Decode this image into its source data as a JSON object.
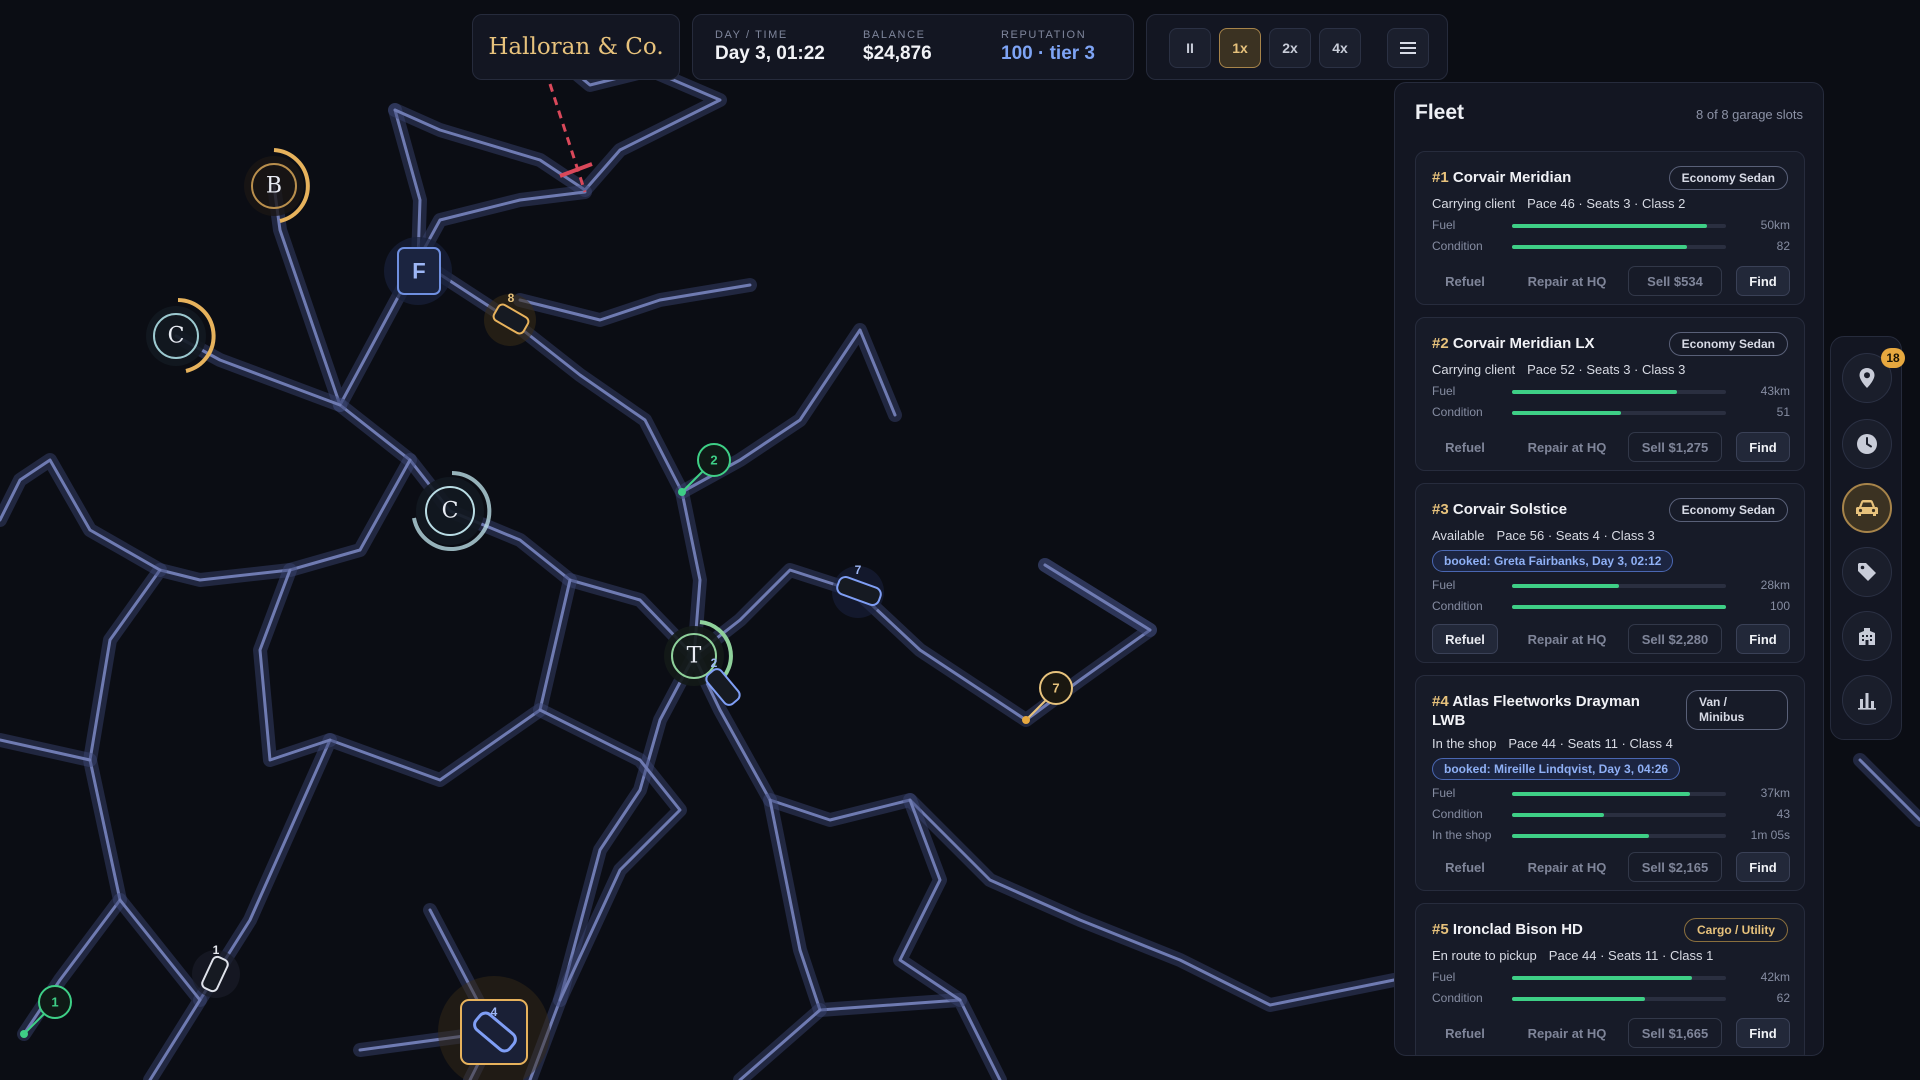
{
  "company": "Halloran & Co.",
  "stats": {
    "day_time_label": "DAY / TIME",
    "day_time": "Day 3, 01:22",
    "balance_label": "BALANCE",
    "balance": "$24,876",
    "reputation_label": "REPUTATION",
    "reputation": "100 · tier 3"
  },
  "speed": {
    "pause": "II",
    "x1": "1x",
    "x2": "2x",
    "x4": "4x",
    "active": "1x"
  },
  "map": {
    "locations": [
      {
        "letter": "B",
        "ring": "#e7b25c"
      },
      {
        "letter": "C",
        "ring": "#e7b25c"
      },
      {
        "letter": "F",
        "ring": "#6f8fe0"
      },
      {
        "letter": "C",
        "ring": "#b9dce4"
      },
      {
        "letter": "T",
        "ring": "#8fd19b"
      }
    ],
    "car_labels": [
      "8",
      "7",
      "2",
      "1",
      "4"
    ],
    "pins": [
      {
        "num": "2",
        "color": "#3ecf86"
      },
      {
        "num": "7",
        "color": "#e7c27c"
      },
      {
        "num": "1",
        "color": "#3ecf86"
      }
    ]
  },
  "fleet": {
    "title": "Fleet",
    "slots": "8 of 8 garage slots",
    "vehicles": [
      {
        "num": "#1",
        "name": "Corvair Meridian",
        "class_badge": "Economy Sedan",
        "status": "Carrying client",
        "specs": "Pace 46 · Seats 3 · Class 2",
        "fuel_label": "Fuel",
        "fuel_value": "50km",
        "fuel_level": 0.91,
        "condition_label": "Condition",
        "condition_value": "82",
        "condition_level": 0.82,
        "refuel": "Refuel",
        "repair": "Repair at HQ",
        "sell": "Sell $534",
        "find": "Find"
      },
      {
        "num": "#2",
        "name": "Corvair Meridian LX",
        "class_badge": "Economy Sedan",
        "status": "Carrying client",
        "specs": "Pace 52 · Seats 3 · Class 3",
        "fuel_label": "Fuel",
        "fuel_value": "43km",
        "fuel_level": 0.77,
        "condition_label": "Condition",
        "condition_value": "51",
        "condition_level": 0.51,
        "refuel": "Refuel",
        "repair": "Repair at HQ",
        "sell": "Sell $1,275",
        "find": "Find"
      },
      {
        "num": "#3",
        "name": "Corvair Solstice",
        "class_badge": "Economy Sedan",
        "status": "Available",
        "specs": "Pace 56 · Seats 4 · Class 3",
        "booked": "booked: Greta Fairbanks, Day 3, 02:12",
        "fuel_label": "Fuel",
        "fuel_value": "28km",
        "fuel_level": 0.5,
        "condition_label": "Condition",
        "condition_value": "100",
        "condition_level": 1.0,
        "refuel": "Refuel",
        "repair": "Repair at HQ",
        "sell": "Sell $2,280",
        "find": "Find"
      },
      {
        "num": "#4",
        "name": "Atlas Fleetworks Drayman LWB",
        "class_badge": "Van / Minibus",
        "status": "In the shop",
        "specs": "Pace 44 · Seats 11 · Class 4",
        "booked": "booked: Mireille Lindqvist, Day 3, 04:26",
        "fuel_label": "Fuel",
        "fuel_value": "37km",
        "fuel_level": 0.83,
        "condition_label": "Condition",
        "condition_value": "43",
        "condition_level": 0.43,
        "shop_label": "In the shop",
        "shop_value": "1m 05s",
        "shop_level": 0.64,
        "refuel": "Refuel",
        "repair": "Repair at HQ",
        "sell": "Sell $2,165",
        "find": "Find"
      },
      {
        "num": "#5",
        "name": "Ironclad Bison HD",
        "class_badge": "Cargo / Utility",
        "status": "En route to pickup",
        "specs": "Pace 44 · Seats 11 · Class 1",
        "fuel_label": "Fuel",
        "fuel_value": "42km",
        "fuel_level": 0.84,
        "condition_label": "Condition",
        "condition_value": "62",
        "condition_level": 0.62,
        "refuel": "Refuel",
        "repair": "Repair at HQ",
        "sell": "Sell $1,665",
        "find": "Find"
      }
    ]
  },
  "toolbar": {
    "items": [
      "location-pin-icon",
      "clock-icon",
      "car-icon",
      "tag-icon",
      "building-icon",
      "bar-chart-icon"
    ],
    "badge": "18",
    "active": "car-icon"
  },
  "colors": {
    "accent": "#e7c27c",
    "fuel": "#3ecf86",
    "booked": "#8fb0f5",
    "road": "#6f7bb2"
  }
}
